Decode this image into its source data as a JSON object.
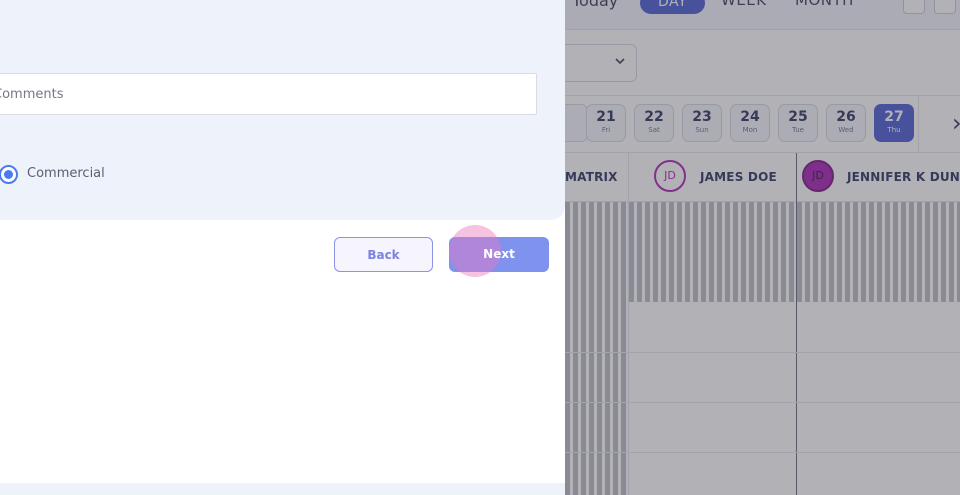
{
  "calendar": {
    "today_label": "Today",
    "views": [
      "DAY",
      "WEEK",
      "MONTH"
    ],
    "active_view": "DAY",
    "dates": [
      {
        "num": "21",
        "dow": "Fri"
      },
      {
        "num": "22",
        "dow": "Sat"
      },
      {
        "num": "23",
        "dow": "Sun"
      },
      {
        "num": "24",
        "dow": "Mon"
      },
      {
        "num": "25",
        "dow": "Tue"
      },
      {
        "num": "26",
        "dow": "Wed"
      },
      {
        "num": "27",
        "dow": "Thu"
      }
    ],
    "selected_date": "27",
    "resources": [
      {
        "name": "MATRIX",
        "initials": ""
      },
      {
        "name": "JAMES DOE",
        "initials": "JD"
      },
      {
        "name": "JENNIFER K DUN...",
        "initials": "JD"
      }
    ]
  },
  "form": {
    "comments_placeholder": "Comments",
    "radio_option_label": "Commercial",
    "back_label": "Back",
    "next_label": "Next"
  }
}
